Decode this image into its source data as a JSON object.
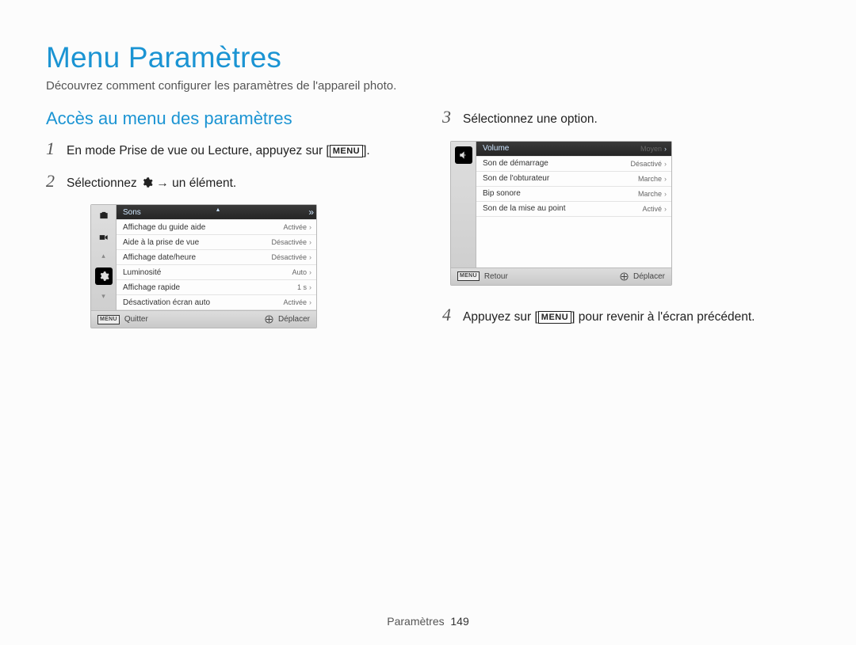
{
  "title": "Menu Paramètres",
  "subtitle": "Découvrez comment configurer les paramètres de l'appareil photo.",
  "heading": "Accès au menu des paramètres",
  "step1": {
    "num": "1",
    "pre": "En mode Prise de vue ou Lecture, appuyez sur [",
    "menu": "MENU",
    "post": "]."
  },
  "step2": {
    "num": "2",
    "pre": "Sélectionnez ",
    "post": " → un élément."
  },
  "step3": {
    "num": "3",
    "text": "Sélectionnez une option."
  },
  "step4": {
    "num": "4",
    "pre": "Appuyez sur [",
    "menu": "MENU",
    "post": "] pour revenir à l'écran précédent."
  },
  "lcd1": {
    "rows": [
      {
        "label": "Sons",
        "value": ""
      },
      {
        "label": "Affichage du guide aide",
        "value": "Activée"
      },
      {
        "label": "Aide à la prise de vue",
        "value": "Désactivée"
      },
      {
        "label": "Affichage date/heure",
        "value": "Désactivée"
      },
      {
        "label": "Luminosité",
        "value": "Auto"
      },
      {
        "label": "Affichage rapide",
        "value": "1 s"
      },
      {
        "label": "Désactivation écran auto",
        "value": "Activée"
      }
    ],
    "footer_left": "Quitter",
    "footer_right": "Déplacer",
    "menu_small": "MENU"
  },
  "lcd2": {
    "rows": [
      {
        "label": "Volume",
        "value": "Moyen"
      },
      {
        "label": "Son de démarrage",
        "value": "Désactivé"
      },
      {
        "label": "Son de l'obturateur",
        "value": "Marche"
      },
      {
        "label": "Bip sonore",
        "value": "Marche"
      },
      {
        "label": "Son de la mise au point",
        "value": "Activé"
      }
    ],
    "footer_left": "Retour",
    "footer_right": "Déplacer",
    "menu_small": "MENU"
  },
  "footer": {
    "section": "Paramètres",
    "page": "149"
  }
}
